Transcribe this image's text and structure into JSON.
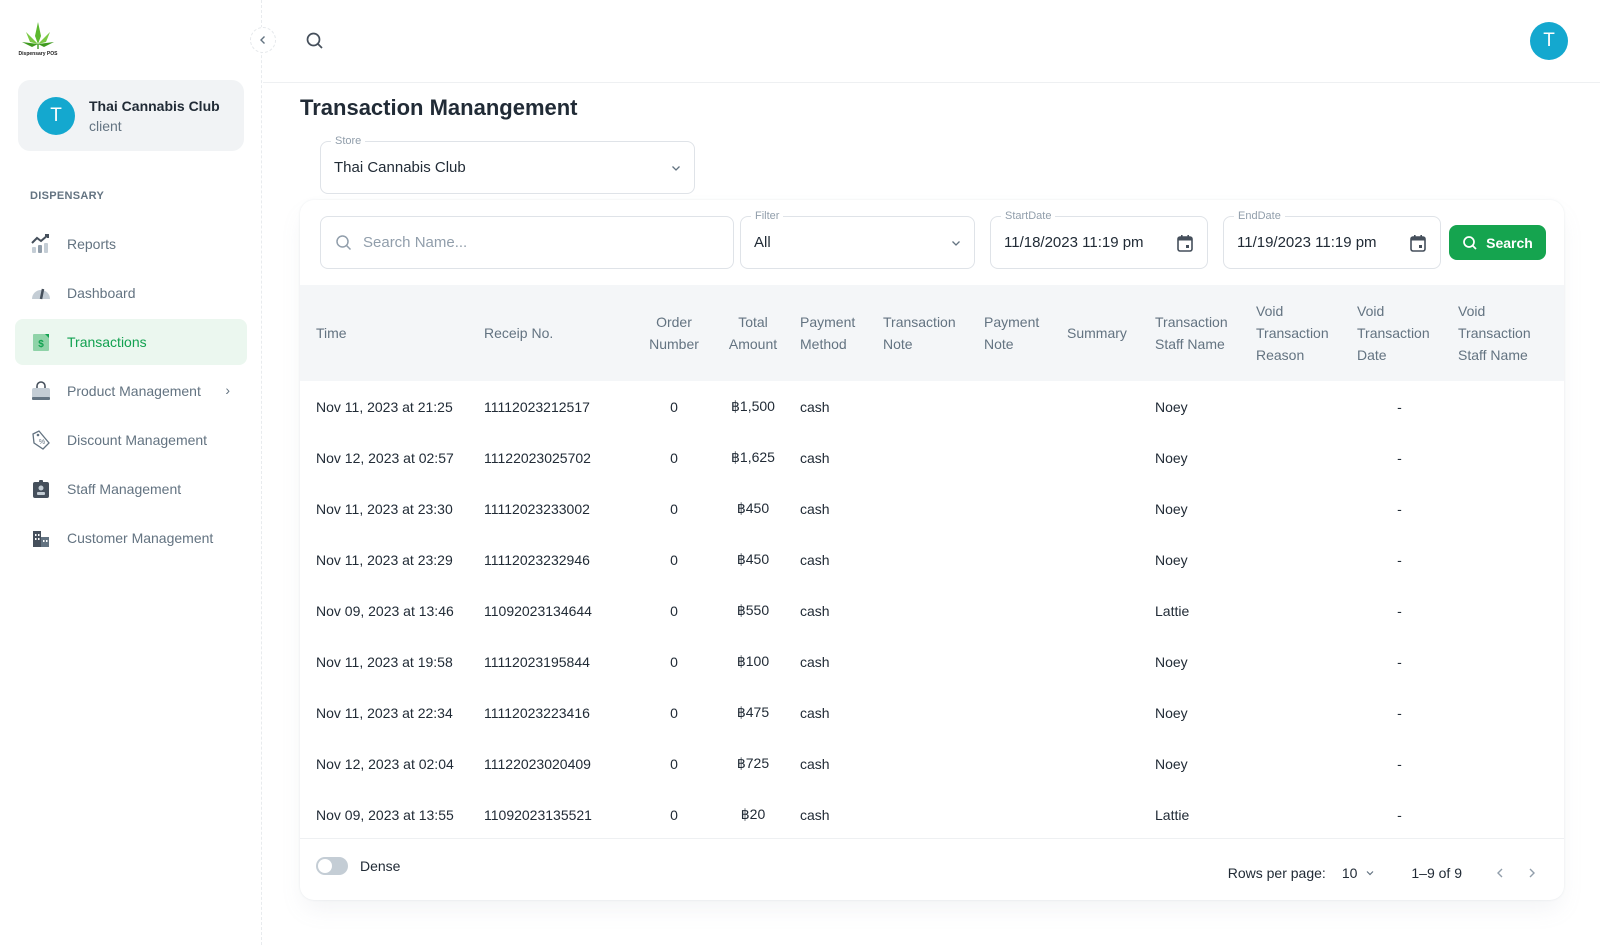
{
  "app": {
    "logo_text": "Dispensary POS"
  },
  "sidebar": {
    "account": {
      "initial": "T",
      "name": "Thai Cannabis Club",
      "role": "client"
    },
    "subheader": "DISPENSARY",
    "items": [
      {
        "label": "Reports",
        "icon": "chart-icon",
        "active": false
      },
      {
        "label": "Dashboard",
        "icon": "gauge-icon",
        "active": false
      },
      {
        "label": "Transactions",
        "icon": "receipt-icon",
        "active": true
      },
      {
        "label": "Product Management",
        "icon": "bag-icon",
        "active": false,
        "has_children": true
      },
      {
        "label": "Discount Management",
        "icon": "discount-tag-icon",
        "active": false
      },
      {
        "label": "Staff Management",
        "icon": "badge-icon",
        "active": false
      },
      {
        "label": "Customer Management",
        "icon": "building-icon",
        "active": false
      }
    ]
  },
  "header": {
    "avatar_initial": "T"
  },
  "page": {
    "title": "Transaction Manangement",
    "store": {
      "label": "Store",
      "value": "Thai Cannabis Club"
    }
  },
  "filters": {
    "search_placeholder": "Search Name...",
    "filter": {
      "label": "Filter",
      "value": "All"
    },
    "start_date": {
      "label": "StartDate",
      "value": "11/18/2023 11:19 pm"
    },
    "end_date": {
      "label": "EndDate",
      "value": "11/19/2023 11:19 pm"
    },
    "search_button": "Search"
  },
  "table": {
    "columns": [
      "Time",
      "Receip No.",
      "Order Number",
      "Total Amount",
      "Payment Method",
      "Transaction Note",
      "Payment Note",
      "Summary",
      "Transaction Staff Name",
      "Void Transaction Reason",
      "Void Transaction Date",
      "Void Transaction Staff Name"
    ],
    "rows": [
      [
        "Nov 11, 2023 at 21:25",
        "11112023212517",
        "0",
        "฿1,500",
        "cash",
        "",
        "",
        "",
        "Noey",
        "",
        "-",
        ""
      ],
      [
        "Nov 12, 2023 at 02:57",
        "11122023025702",
        "0",
        "฿1,625",
        "cash",
        "",
        "",
        "",
        "Noey",
        "",
        "-",
        ""
      ],
      [
        "Nov 11, 2023 at 23:30",
        "11112023233002",
        "0",
        "฿450",
        "cash",
        "",
        "",
        "",
        "Noey",
        "",
        "-",
        ""
      ],
      [
        "Nov 11, 2023 at 23:29",
        "11112023232946",
        "0",
        "฿450",
        "cash",
        "",
        "",
        "",
        "Noey",
        "",
        "-",
        ""
      ],
      [
        "Nov 09, 2023 at 13:46",
        "11092023134644",
        "0",
        "฿550",
        "cash",
        "",
        "",
        "",
        "Lattie",
        "",
        "-",
        ""
      ],
      [
        "Nov 11, 2023 at 19:58",
        "11112023195844",
        "0",
        "฿100",
        "cash",
        "",
        "",
        "",
        "Noey",
        "",
        "-",
        ""
      ],
      [
        "Nov 11, 2023 at 22:34",
        "11112023223416",
        "0",
        "฿475",
        "cash",
        "",
        "",
        "",
        "Noey",
        "",
        "-",
        ""
      ],
      [
        "Nov 12, 2023 at 02:04",
        "11122023020409",
        "0",
        "฿725",
        "cash",
        "",
        "",
        "",
        "Noey",
        "",
        "-",
        ""
      ],
      [
        "Nov 09, 2023 at 13:55",
        "11092023135521",
        "0",
        "฿20",
        "cash",
        "",
        "",
        "",
        "Lattie",
        "",
        "-",
        ""
      ]
    ]
  },
  "footer": {
    "dense_label": "Dense",
    "dense_on": false,
    "rows_per_page_label": "Rows per page:",
    "rows_per_page": "10",
    "range": "1–9 of 9"
  },
  "colors": {
    "accent": "#15a44f",
    "avatar": "#14a8cf"
  }
}
